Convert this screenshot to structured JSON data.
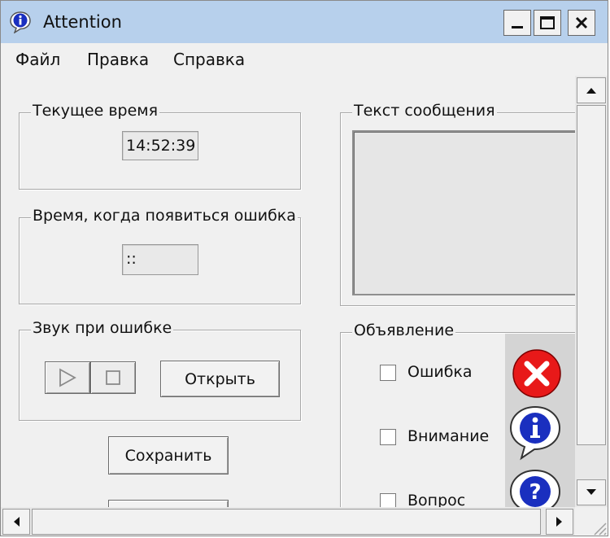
{
  "window": {
    "title": "Attention"
  },
  "menu": {
    "items": [
      "Файл",
      "Правка",
      "Справка"
    ]
  },
  "current_time": {
    "title": "Текущее время",
    "value": "14:52:39"
  },
  "error_time": {
    "title": "Время, когда появиться ошибка",
    "value": "::"
  },
  "sound": {
    "title": "Звук при ошибке",
    "open_label": "Открыть"
  },
  "save_label": "Сохранить",
  "message": {
    "title": "Текст сообщения",
    "value": ""
  },
  "announcement": {
    "title": "Объявление",
    "options": [
      {
        "label": "Ошибка",
        "checked": false
      },
      {
        "label": "Внимание",
        "checked": false
      },
      {
        "label": "Вопрос",
        "checked": false
      }
    ]
  },
  "colors": {
    "titlebar": "#b7d0ec",
    "error_icon": "#e81919",
    "info_icon": "#1a2fbf"
  },
  "icons": [
    "info-icon",
    "minimize-icon",
    "maximize-icon",
    "close-icon",
    "play-icon",
    "stop-icon",
    "error-icon",
    "information-icon",
    "question-icon"
  ]
}
